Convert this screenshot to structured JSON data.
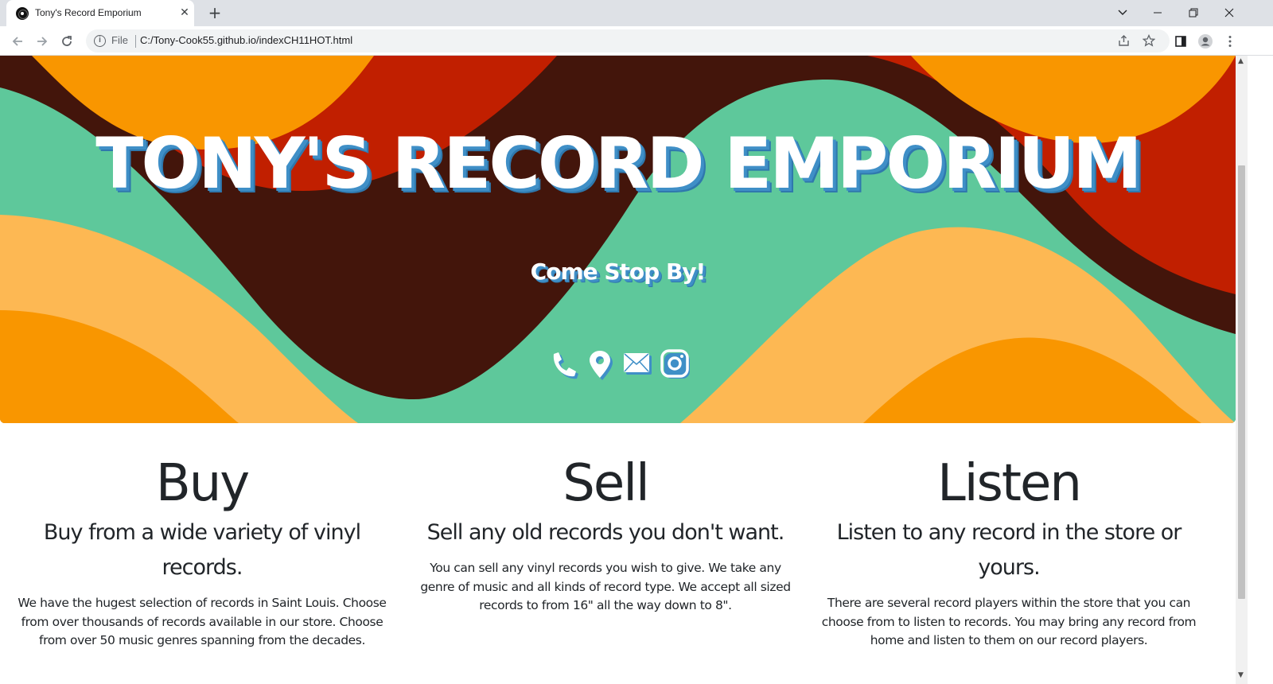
{
  "browser": {
    "tab_title": "Tony's Record Emporium",
    "tab_close": "✕",
    "new_tab": "+",
    "file_label": "File",
    "url": "C:/Tony-Cook55.github.io/indexCH11HOT.html",
    "icons": [
      "back-icon",
      "forward-icon",
      "reload-icon",
      "info-icon",
      "share-icon",
      "star-icon",
      "sidepanel-icon",
      "profile-icon",
      "menu-icon"
    ]
  },
  "hero": {
    "title": "TONY'S RECORD EMPORIUM",
    "subtitle": "Come Stop By!",
    "social_icons": [
      "phone-icon",
      "location-icon",
      "mail-icon",
      "instagram-icon"
    ],
    "colors": {
      "dark": "#43150b",
      "red": "#c11f00",
      "orange": "#f99600",
      "light_orange": "#fdb853",
      "green": "#5ec89b",
      "text_shadow": "#3f8fc7"
    }
  },
  "sections": [
    {
      "title": "Buy",
      "lead": "Buy from a wide variety of vinyl records.",
      "body": "We have the hugest selection of records in Saint Louis. Choose from over thousands of records available in our store. Choose from over 50 music genres spanning from the decades."
    },
    {
      "title": "Sell",
      "lead": "Sell any old records you don't want.",
      "body": "You can sell any vinyl records you wish to give. We take any genre of music and all kinds of record type. We accept all sized records to from 16\" all the way down to 8\"."
    },
    {
      "title": "Listen",
      "lead": "Listen to any record in the store or yours.",
      "body": "There are several record players within the store that you can choose from to listen to records. You may bring any record from home and listen to them on our record players."
    }
  ]
}
